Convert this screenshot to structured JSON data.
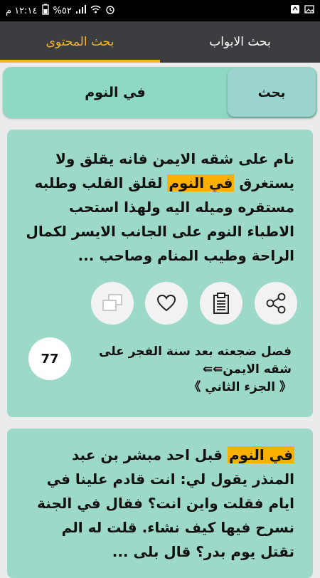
{
  "status_bar": {
    "time": "١٢:١٤ م",
    "battery": "%٥٢"
  },
  "tabs": [
    {
      "label": "بحث المحتوى",
      "active": true
    },
    {
      "label": "بحث الابواب",
      "active": false
    }
  ],
  "search": {
    "query": "في النوم",
    "button_label": "بحث"
  },
  "results": [
    {
      "text_before": "نام على شقه الايمن فانه يقلق ولا يستغرق ",
      "highlight": "في النوم",
      "text_after": " لقلق القلب وطلبه مستقره وميله اليه ولهذا استحب الاطباء النوم على الجانب الايسر لكمال الراحة وطيب المنام وصاحب ...",
      "source": "فصل ضجعته بعد سنة الفجر على شقه الايمن⇚⇚",
      "part": "《 الجزء الثاني 》",
      "count": "77",
      "actions": [
        "share-icon",
        "clipboard-icon",
        "heart-icon",
        "copy-icon"
      ]
    },
    {
      "text_before": "",
      "highlight": "في النوم",
      "text_after": " قبل احد مبشر بن عبد المنذر يقول لي: انت قادم علينا في ايام فقلت واين انت؟ فقال في الجنة نسرح فيها كيف نشاء. قلت له الم تقتل يوم بدر؟ قال بلى ..."
    }
  ],
  "colors": {
    "accent": "#f4b528",
    "tab_bar": "#3b3d40",
    "card": "#9dd9c9",
    "highlight": "#fbb000"
  }
}
